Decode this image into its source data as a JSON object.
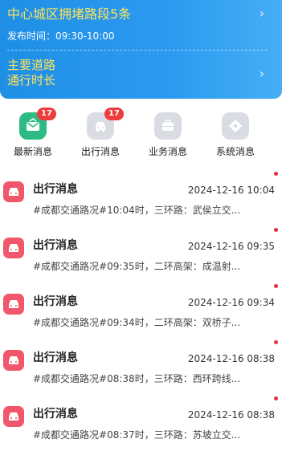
{
  "banner": {
    "title": "中心城区拥堵路段5条",
    "time": "发布时间：09:30-10:00",
    "subtitle": "主要道路\n通行时长",
    "accent_color": "#ffe45a",
    "background_color": "#1f8fe6"
  },
  "categories": [
    {
      "label": "最新消息",
      "badge": "17",
      "icon": "mail-icon"
    },
    {
      "label": "出行消息",
      "badge": "17",
      "icon": "car-icon"
    },
    {
      "label": "业务消息",
      "badge": "",
      "icon": "briefcase-icon"
    },
    {
      "label": "系统消息",
      "badge": "",
      "icon": "gear-icon"
    }
  ],
  "messages": [
    {
      "title": "出行消息",
      "time": "2024-12-16 10:04",
      "body": "#成都交通路况#10:04时，三环路：武侯立交..."
    },
    {
      "title": "出行消息",
      "time": "2024-12-16 09:35",
      "body": "#成都交通路况#09:35时，二环高架：成温射..."
    },
    {
      "title": "出行消息",
      "time": "2024-12-16 09:34",
      "body": "#成都交通路况#09:34时，二环高架：双桥子..."
    },
    {
      "title": "出行消息",
      "time": "2024-12-16 08:38",
      "body": "#成都交通路况#08:38时，三环路：西环跨线..."
    },
    {
      "title": "出行消息",
      "time": "2024-12-16 08:38",
      "body": "#成都交通路况#08:37时，三环路：苏坡立交..."
    }
  ]
}
